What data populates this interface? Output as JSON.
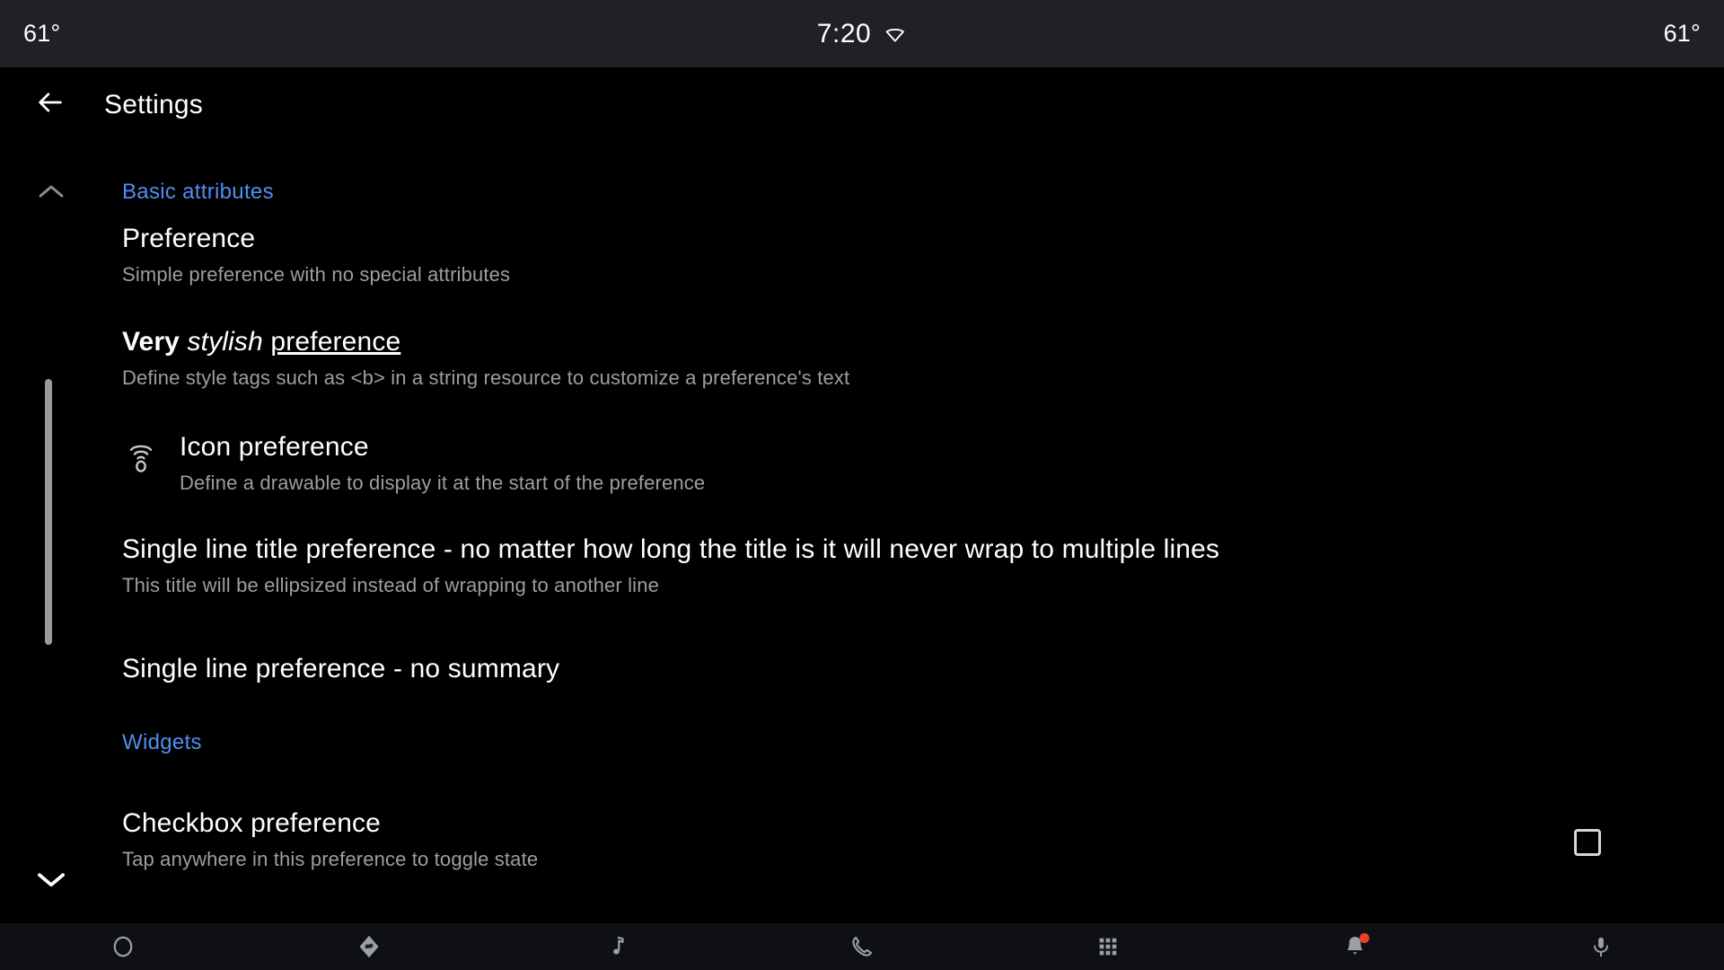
{
  "status_bar": {
    "left_temperature": "61°",
    "right_temperature": "61°",
    "clock": "7:20",
    "wifi_icon": "wifi-icon"
  },
  "app_bar": {
    "back_icon": "back-arrow-icon",
    "title": "Settings"
  },
  "colors": {
    "accent_blue": "#4f8ff0",
    "background": "#000000",
    "status_bar_bg": "#202124",
    "nav_bar_bg": "#0e1013",
    "summary_text": "#9e9e9e",
    "title_text": "#ffffff",
    "badge_red": "#e8412c"
  },
  "scroll": {
    "up_chevron_icon": "chevron-up-icon",
    "down_chevron_icon": "chevron-down-icon"
  },
  "sections": [
    {
      "header": "Basic attributes",
      "items": [
        {
          "title": "Preference",
          "summary": "Simple preference with no special attributes"
        },
        {
          "title_parts": {
            "bold": "Very",
            "italic": "stylish",
            "underline": "preference"
          },
          "summary": "Define style tags such as <b> in a string resource to customize a preference's text"
        },
        {
          "icon": "wifi-tethering-icon",
          "title": "Icon preference",
          "summary": "Define a drawable to display it at the start of the preference"
        },
        {
          "title": "Single line title preference - no matter how long the title is it will never wrap to multiple lines",
          "summary": "This title will be ellipsized instead of wrapping to another line"
        },
        {
          "title": "Single line preference - no summary",
          "summary": ""
        }
      ]
    },
    {
      "header": "Widgets",
      "items": [
        {
          "title": "Checkbox preference",
          "summary": "Tap anywhere in this preference to toggle state",
          "widget": "checkbox",
          "checked": false
        }
      ]
    }
  ],
  "bottom_nav": [
    {
      "icon": "home-circle-icon",
      "label": "Home"
    },
    {
      "icon": "navigation-arrow-icon",
      "label": "Navigation"
    },
    {
      "icon": "music-note-icon",
      "label": "Media"
    },
    {
      "icon": "phone-icon",
      "label": "Phone"
    },
    {
      "icon": "apps-grid-icon",
      "label": "Apps"
    },
    {
      "icon": "bell-icon",
      "label": "Notifications",
      "badge": true
    },
    {
      "icon": "microphone-icon",
      "label": "Assistant"
    }
  ]
}
